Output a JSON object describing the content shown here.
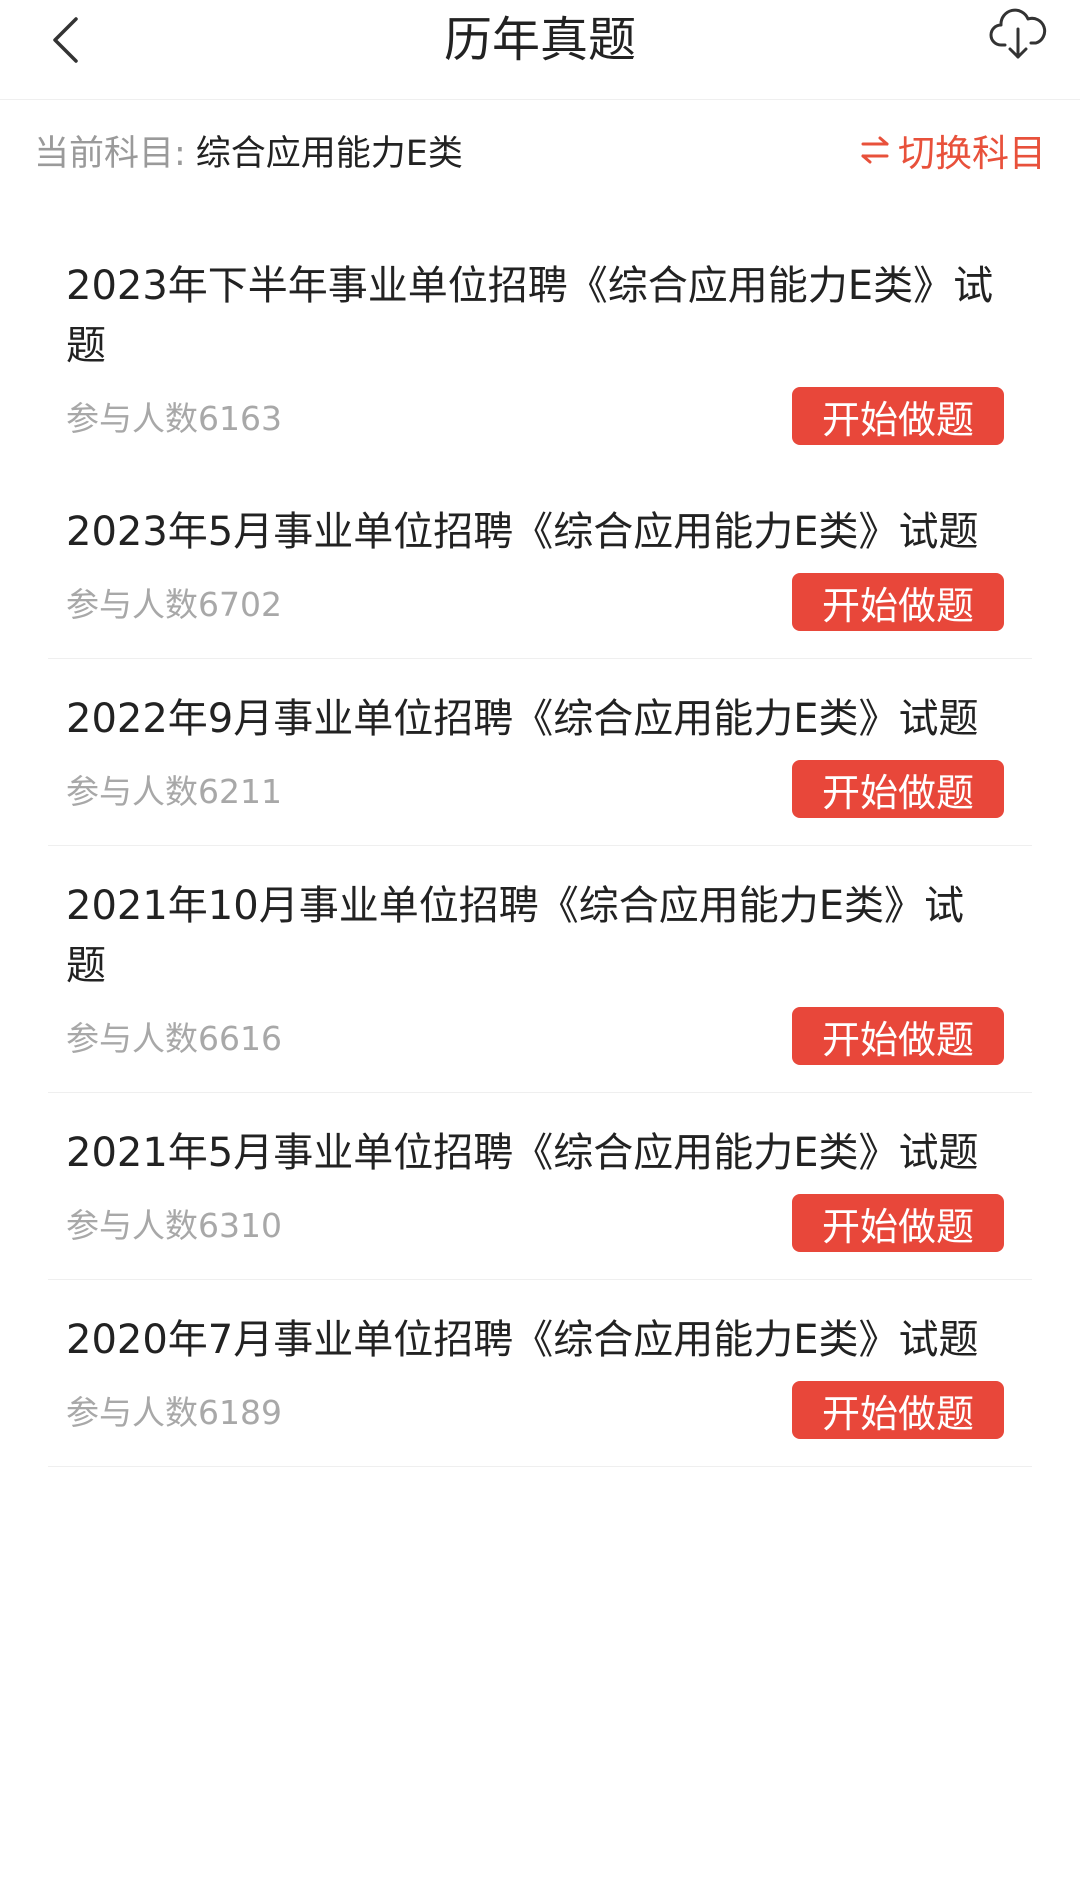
{
  "header": {
    "title": "历年真题",
    "back_icon": "chevron-left-icon",
    "download_icon": "cloud-download-icon"
  },
  "subject": {
    "label": "当前科目:",
    "value": "综合应用能力E类",
    "switch_label": "切换科目",
    "switch_icon": "swap-arrows-icon",
    "accent_color": "#e8513b"
  },
  "exams": [
    {
      "title": "2023年下半年事业单位招聘《综合应用能力E类》试题",
      "count": "参与人数6163",
      "button": "开始做题"
    },
    {
      "title": "2023年5月事业单位招聘《综合应用能力E类》试题",
      "count": "参与人数6702",
      "button": "开始做题"
    },
    {
      "title": "2022年9月事业单位招聘《综合应用能力E类》试题",
      "count": "参与人数6211",
      "button": "开始做题"
    },
    {
      "title": "2021年10月事业单位招聘《综合应用能力E类》试题",
      "count": "参与人数6616",
      "button": "开始做题"
    },
    {
      "title": "2021年5月事业单位招聘《综合应用能力E类》试题",
      "count": "参与人数6310",
      "button": "开始做题"
    },
    {
      "title": "2020年7月事业单位招聘《综合应用能力E类》试题",
      "count": "参与人数6189",
      "button": "开始做题"
    }
  ]
}
